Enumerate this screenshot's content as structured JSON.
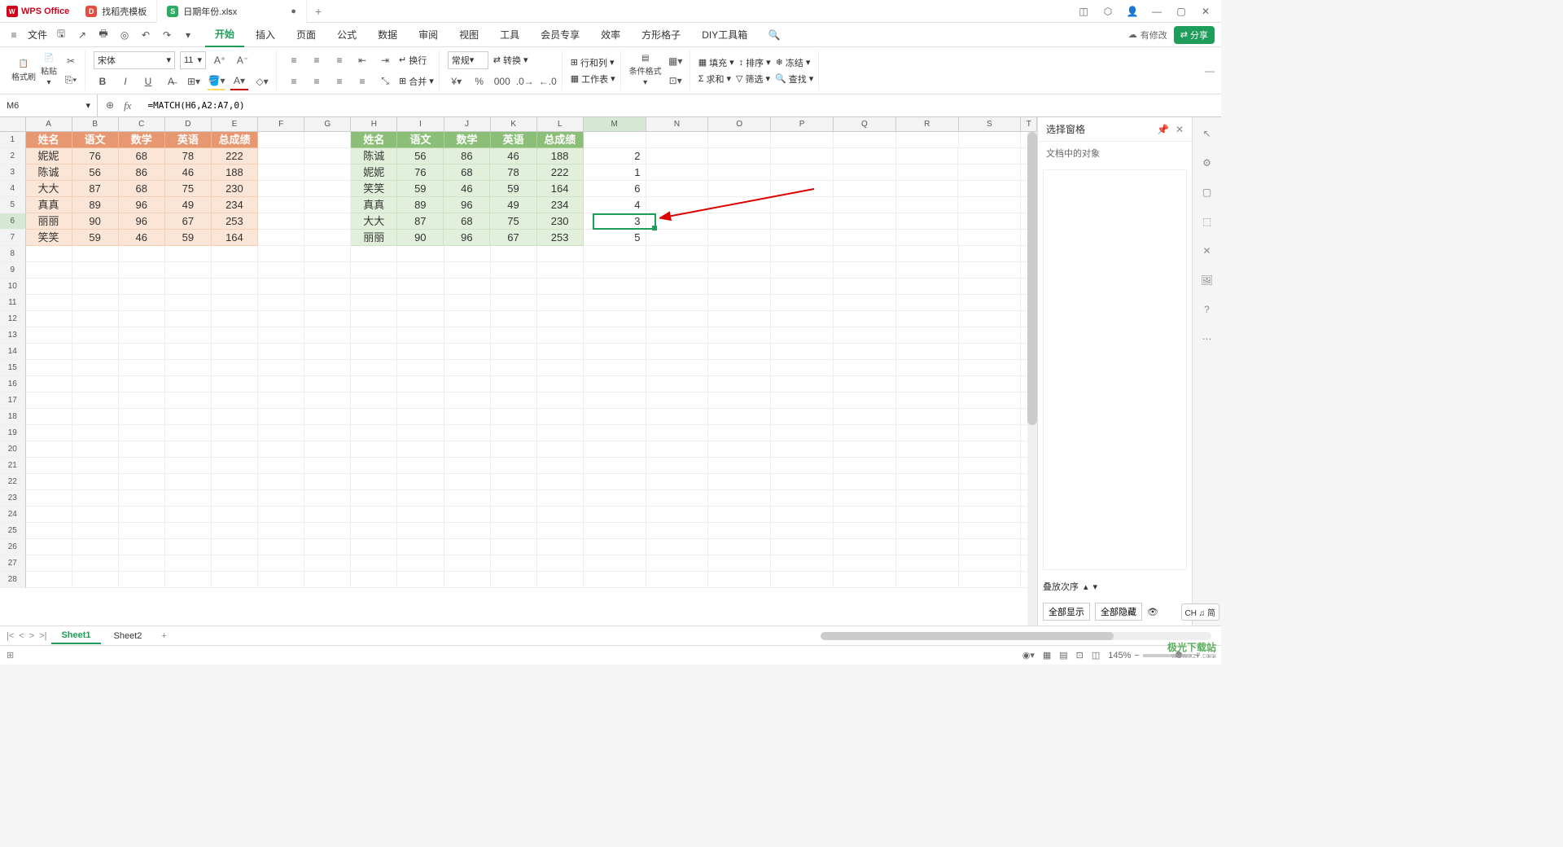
{
  "app_name": "WPS Office",
  "tabs": [
    {
      "label": "找稻壳模板",
      "icon": "red"
    },
    {
      "label": "日期年份.xlsx",
      "icon": "green",
      "active": true,
      "modified": "●"
    }
  ],
  "menu": {
    "file": "文件",
    "items": [
      "开始",
      "插入",
      "页面",
      "公式",
      "数据",
      "审阅",
      "视图",
      "工具",
      "会员专享",
      "效率",
      "方形格子",
      "DIY工具箱"
    ],
    "active": "开始",
    "edit_status": "有修改",
    "share": "分享"
  },
  "ribbon": {
    "format_painter": "格式刷",
    "paste": "粘贴",
    "font_name": "宋体",
    "font_size": "11",
    "wrap": "换行",
    "number_format": "常规",
    "convert": "转换",
    "row_col": "行和列",
    "worksheet": "工作表",
    "cond_fmt": "条件格式",
    "fill": "填充",
    "sort": "排序",
    "freeze": "冻结",
    "sum": "求和",
    "filter": "筛选",
    "find": "查找",
    "merge": "合并"
  },
  "formula_bar": {
    "cell_ref": "M6",
    "formula": "=MATCH(H6,A2:A7,0)"
  },
  "columns": [
    "A",
    "B",
    "C",
    "D",
    "E",
    "F",
    "G",
    "H",
    "I",
    "J",
    "K",
    "L",
    "M",
    "N",
    "O",
    "P",
    "Q",
    "R",
    "S",
    "T"
  ],
  "headers1": [
    "姓名",
    "语文",
    "数学",
    "英语",
    "总成绩"
  ],
  "headers2": [
    "姓名",
    "语文",
    "数学",
    "英语",
    "总成绩"
  ],
  "table1": [
    [
      "妮妮",
      "76",
      "68",
      "78",
      "222"
    ],
    [
      "陈诚",
      "56",
      "86",
      "46",
      "188"
    ],
    [
      "大大",
      "87",
      "68",
      "75",
      "230"
    ],
    [
      "真真",
      "89",
      "96",
      "49",
      "234"
    ],
    [
      "丽丽",
      "90",
      "96",
      "67",
      "253"
    ],
    [
      "笑笑",
      "59",
      "46",
      "59",
      "164"
    ]
  ],
  "table2": [
    [
      "陈诚",
      "56",
      "86",
      "46",
      "188"
    ],
    [
      "妮妮",
      "76",
      "68",
      "78",
      "222"
    ],
    [
      "笑笑",
      "59",
      "46",
      "59",
      "164"
    ],
    [
      "真真",
      "89",
      "96",
      "49",
      "234"
    ],
    [
      "大大",
      "87",
      "68",
      "75",
      "230"
    ],
    [
      "丽丽",
      "90",
      "96",
      "67",
      "253"
    ]
  ],
  "colM": [
    "2",
    "1",
    "6",
    "4",
    "3",
    "5"
  ],
  "selection_pane": {
    "title": "选择窗格",
    "subtitle": "文档中的对象",
    "stack_order": "叠放次序",
    "show_all": "全部显示",
    "hide_all": "全部隐藏"
  },
  "sheets": {
    "s1": "Sheet1",
    "s2": "Sheet2"
  },
  "status": {
    "zoom": "145%",
    "ime": "CH ♫ 简"
  },
  "watermark": {
    "line1": "极光下载站",
    "line2": "www.xz7.com"
  }
}
